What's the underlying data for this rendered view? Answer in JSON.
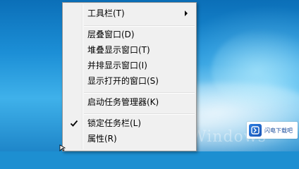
{
  "menu": {
    "items": [
      {
        "label": "工具栏(T)",
        "submenu": true,
        "checked": false
      },
      {
        "label": "层叠窗口(D)",
        "submenu": false,
        "checked": false
      },
      {
        "label": "堆叠显示窗口(T)",
        "submenu": false,
        "checked": false
      },
      {
        "label": "并排显示窗口(I)",
        "submenu": false,
        "checked": false
      },
      {
        "label": "显示打开的窗口(S)",
        "submenu": false,
        "checked": false
      },
      {
        "label": "启动任务管理器(K)",
        "submenu": false,
        "checked": false
      },
      {
        "label": "锁定任务栏(L)",
        "submenu": false,
        "checked": true
      },
      {
        "label": "属性(R)",
        "submenu": false,
        "checked": false
      }
    ]
  },
  "desktop": {
    "logo_text": "Windows"
  },
  "watermark": {
    "text": "闪电下载吧"
  },
  "colors": {
    "menu_background": "#f0f0f0",
    "menu_border": "#979797",
    "desktop_blue": "#1c8fd6"
  }
}
